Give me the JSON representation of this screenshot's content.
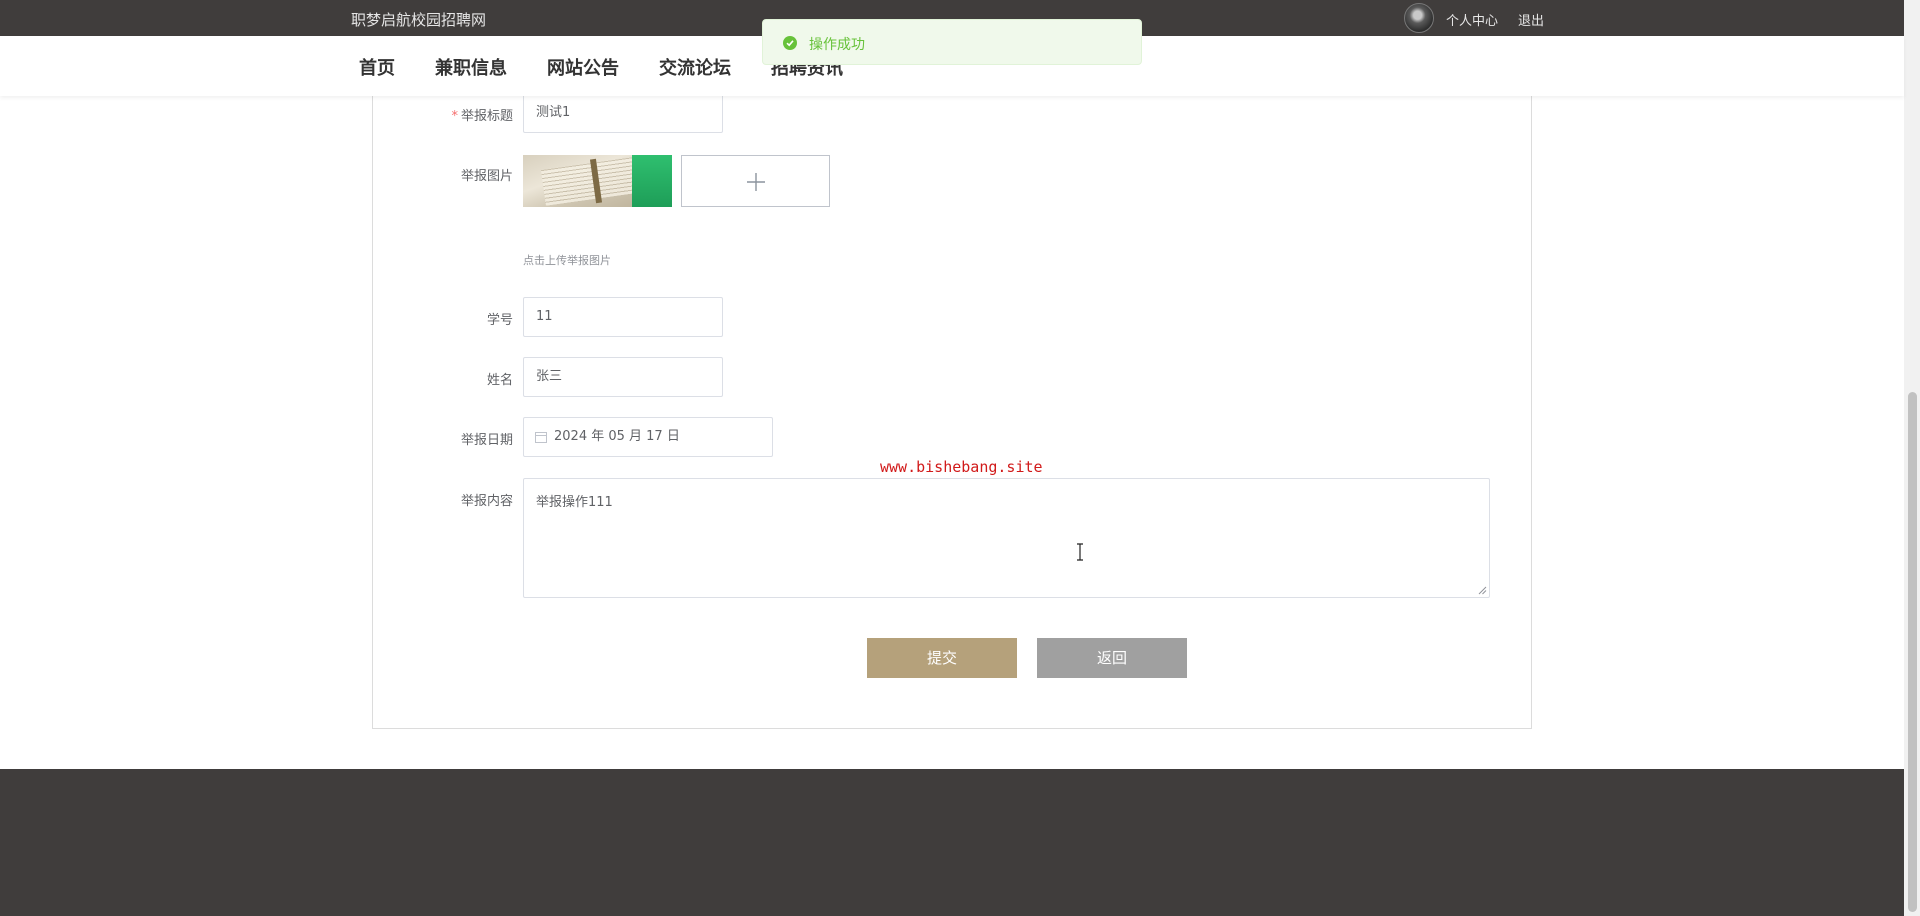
{
  "header": {
    "site_title": "职梦启航校园招聘网",
    "profile_link": "个人中心",
    "logout_link": "退出"
  },
  "nav": {
    "items": [
      {
        "label": "首页"
      },
      {
        "label": "兼职信息"
      },
      {
        "label": "网站公告"
      },
      {
        "label": "交流论坛"
      },
      {
        "label": "招聘资讯"
      }
    ]
  },
  "toast": {
    "message": "操作成功",
    "type": "success",
    "color": "#67c23a"
  },
  "form": {
    "title_label": "举报标题",
    "title_required_mark": "*",
    "title_value": "测试1",
    "image_label": "举报图片",
    "image_hint": "点击上传举报图片",
    "student_id_label": "学号",
    "student_id_value": "11",
    "name_label": "姓名",
    "name_value": "张三",
    "date_label": "举报日期",
    "date_value": "2024 年 05 月 17 日",
    "content_label": "举报内容",
    "content_value": "举报操作111",
    "submit_label": "提交",
    "back_label": "返回"
  },
  "watermark": "www.bishebang.site",
  "colors": {
    "header_bg": "#403d3c",
    "submit_bg": "#b5a17b",
    "back_bg": "#a0a0a0",
    "watermark": "#d11a1a"
  },
  "icons": {
    "toast": "check-circle-icon",
    "upload": "plus-icon",
    "date": "calendar-icon"
  }
}
